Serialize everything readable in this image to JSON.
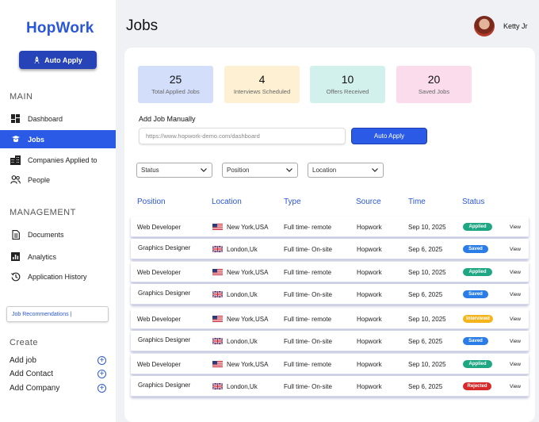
{
  "app": {
    "name": "HopWork",
    "auto_apply_label": "Auto Apply"
  },
  "sidebar": {
    "main_heading": "MAIN",
    "main_items": [
      {
        "label": "Dashboard",
        "icon": "dashboard-icon"
      },
      {
        "label": "Jobs",
        "icon": "jobs-icon",
        "active": true
      },
      {
        "label": "Companies Applied to",
        "icon": "building-icon"
      },
      {
        "label": "People",
        "icon": "people-icon"
      }
    ],
    "management_heading": "MANAGEMENT",
    "management_items": [
      {
        "label": "Documents",
        "icon": "document-icon"
      },
      {
        "label": "Analytics",
        "icon": "analytics-icon"
      },
      {
        "label": "Application History",
        "icon": "history-icon"
      }
    ],
    "job_recommendations": "Job Recommendations |",
    "create_heading": "Create",
    "create_items": [
      "Add job",
      "Add Contact",
      "Add Company"
    ]
  },
  "header": {
    "title": "Jobs",
    "user_name": "Ketty Jr"
  },
  "stats": [
    {
      "value": "25",
      "label": "Total Applied Jobs",
      "color": "#d3defa"
    },
    {
      "value": "4",
      "label": "Interviews Scheduled",
      "color": "#fdf0d3"
    },
    {
      "value": "10",
      "label": "Offers Received",
      "color": "#d3f1ec"
    },
    {
      "value": "20",
      "label": "Saved Jobs",
      "color": "#fbdcec"
    }
  ],
  "add_job": {
    "label": "Add Job Manually",
    "placeholder": "https://www.hopwork-demo.com/dashboard",
    "button": "Auto Apply"
  },
  "filters": [
    "Status",
    "Position",
    "Location"
  ],
  "table": {
    "headers": [
      "Position",
      "Location",
      "Type",
      "Source",
      "Time",
      "Status"
    ],
    "view_label": "View",
    "rows": [
      {
        "position": "Web Developer",
        "flag": "us",
        "location": "New York,USA",
        "type": "Full time- remote",
        "source": "Hopwork",
        "time": "Sep 10, 2025",
        "status": "Applied"
      },
      {
        "position": "Graphics Designer",
        "flag": "uk",
        "location": "London,Uk",
        "type": "Full time- On-site",
        "source": "Hopwork",
        "time": "Sep 6, 2025",
        "status": "Saved"
      },
      {
        "position": "Web Developer",
        "flag": "us",
        "location": "New York,USA",
        "type": "Full time- remote",
        "source": "Hopwork",
        "time": "Sep 10, 2025",
        "status": "Applied"
      },
      {
        "position": "Graphics Designer",
        "flag": "uk",
        "location": "London,Uk",
        "type": "Full time- On-site",
        "source": "Hopwork",
        "time": "Sep 6, 2025",
        "status": "Saved"
      },
      {
        "position": "Web Developer",
        "flag": "us",
        "location": "New York,USA",
        "type": "Full time- remote",
        "source": "Hopwork",
        "time": "Sep 10, 2025",
        "status": "Interviewd"
      },
      {
        "position": "Graphics Designer",
        "flag": "uk",
        "location": "London,Uk",
        "type": "Full time- On-site",
        "source": "Hopwork",
        "time": "Sep 6, 2025",
        "status": "Saved"
      },
      {
        "position": "Web Developer",
        "flag": "us",
        "location": "New York,USA",
        "type": "Full time- remote",
        "source": "Hopwork",
        "time": "Sep 10, 2025",
        "status": "Applied"
      },
      {
        "position": "Graphics Designer",
        "flag": "uk",
        "location": "London,Uk",
        "type": "Full time- On-site",
        "source": "Hopwork",
        "time": "Sep 6, 2025",
        "status": "Rejected"
      }
    ]
  },
  "status_colors": {
    "Applied": "#1fa784",
    "Saved": "#2a7de6",
    "Interviewd": "#f4b41c",
    "Rejected": "#d62a2a"
  }
}
